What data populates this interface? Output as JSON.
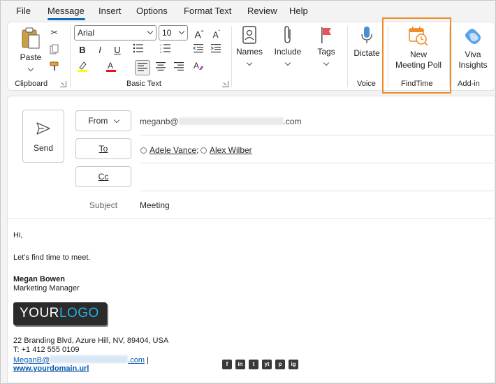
{
  "menu": {
    "items": [
      {
        "label": "File"
      },
      {
        "label": "Message",
        "active": true
      },
      {
        "label": "Insert"
      },
      {
        "label": "Options"
      },
      {
        "label": "Format Text"
      },
      {
        "label": "Review"
      },
      {
        "label": "Help"
      }
    ]
  },
  "ribbon": {
    "clipboard": {
      "paste_label": "Paste",
      "group_label": "Clipboard"
    },
    "basic_text": {
      "font_name": "Arial",
      "font_size": "10",
      "group_label": "Basic Text",
      "bold": "B",
      "italic": "I",
      "underline": "U"
    },
    "names": {
      "label": "Names"
    },
    "include": {
      "label": "Include"
    },
    "tags": {
      "label": "Tags"
    },
    "voice": {
      "dictate_label": "Dictate",
      "group_label": "Voice"
    },
    "findtime": {
      "line1": "New",
      "line2": "Meeting Poll",
      "group_label": "FindTime"
    },
    "addin": {
      "line1": "Viva",
      "line2": "Insights",
      "group_label": "Add-in"
    },
    "colors": {
      "highlight": "#ffff00",
      "font_color": "#e81123",
      "accent": "#0f6cbd",
      "findtime_outline": "#f08c28"
    }
  },
  "compose": {
    "send_label": "Send",
    "from_label": "From",
    "from_value_prefix": "meganb@",
    "from_value_suffix": ".com",
    "to_label": "To",
    "recipients": [
      "Adele Vance",
      "Alex Wilber"
    ],
    "cc_label": "Cc",
    "subject_label": "Subject",
    "subject_value": "Meeting"
  },
  "body": {
    "greeting": "Hi,",
    "message": "Let’s find time to meet.",
    "sig_name": "Megan Bowen",
    "sig_title": "Marketing Manager",
    "logo_part1": "YOUR",
    "logo_part2": "LOGO",
    "address": "22 Branding Blvd, Azure Hill, NV, 89404, USA",
    "phone": "T: +1 412 555 0109",
    "email_prefix": "MeganB@",
    "email_suffix": ".com",
    "email_sep": "|",
    "website": "www.yourdomain.url",
    "social": [
      "f",
      "in",
      "t",
      "yt",
      "p",
      "ig"
    ]
  }
}
